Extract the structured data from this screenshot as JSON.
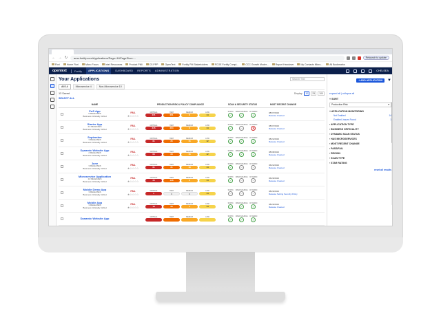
{
  "browser": {
    "url": "ams.fortify.com/Applications/Page=1&PageSize=..."
  },
  "bookmarks": [
    "Fiori",
    "Home Fiori",
    "Micro Focus",
    "Intel Resources",
    "Product PMI",
    "CS PPP",
    "OpenText",
    "Fortify PM Stakeholders",
    "FCOE Fortify Compl...",
    "CCC Growth Moder...",
    "Report Handover",
    "My Contacts Micro...",
    "All Bookmarks"
  ],
  "app_header": {
    "logo": "opentext",
    "product": "Fortify",
    "nav": [
      "APPLICATIONS",
      "DASHBOARD",
      "REPORTS",
      "ADMINISTRATION"
    ],
    "user": "CHELSEA"
  },
  "main": {
    "title": "Your Applications",
    "search_placeholder": "Search Text",
    "tabs": [
      {
        "label": "All  14"
      },
      {
        "label": "Microservice  4"
      },
      {
        "label": "Non-Microservice  10"
      }
    ],
    "saved": "13 Saved",
    "display_label": "Display:",
    "page_sizes": [
      "10",
      "25",
      "100"
    ],
    "select_all": "SELECT ALL",
    "headers": {
      "name": "NAME",
      "risk": "PRODUCTION RISK & POLICY COMPLIANCE",
      "scan": "SCAN & SECURITY STATUS",
      "change": "MOST RECENT CHANGE"
    },
    "risk_labels": [
      "CRITICAL",
      "HIGH",
      "MEDIUM",
      "LOW"
    ],
    "status_labels": [
      "STATIC",
      "OPEN SOURCE",
      "DYNAMIC"
    ],
    "rows": [
      {
        "name": "PoS App",
        "sub1": "5 RELEASES",
        "sub2": "Business Criticality: HIGH",
        "rating": "FAIL",
        "risk": [
          "471",
          "261",
          "6",
          "14"
        ],
        "status": [
          "ok",
          "ok",
          "ok"
        ],
        "date": "08/07/2023",
        "change": "Release Created"
      },
      {
        "name": "Starter App",
        "sub1": "21 RELEASES",
        "sub2": "Business Criticality: HIGH",
        "rating": "FAIL",
        "risk": [
          "345",
          "264",
          "6",
          "14"
        ],
        "status": [
          "ok",
          "none",
          "fail"
        ],
        "date": "08/07/2023",
        "change": "Release Created"
      },
      {
        "name": "September",
        "sub1": "3 RELEASES",
        "sub2": "Business Criticality: HIGH",
        "rating": "FAIL",
        "risk": [
          "61",
          "25",
          "15",
          "12"
        ],
        "status": [
          "ok",
          "ok",
          "ok"
        ],
        "date": "08/22/2023",
        "change": "Release Created"
      },
      {
        "name": "Dynamic Website App",
        "sub1": "2 RELEASES",
        "sub2": "Business Criticality: HIGH",
        "rating": "FAIL",
        "risk": [
          "63",
          "23",
          "16",
          "12"
        ],
        "status": [
          "ok",
          "ok",
          "ok"
        ],
        "date": "08/08/2023",
        "change": "Release Created"
      },
      {
        "name": "June",
        "sub1": "3 RELEASES",
        "sub2": "Business Criticality: HIGH",
        "rating": "FAIL",
        "risk": [
          "61",
          "21",
          "18",
          "14"
        ],
        "status": [
          "ok",
          "none",
          "none"
        ],
        "date": "06/22/2023",
        "change": "Release Created"
      },
      {
        "name": "Microservice Application",
        "sub1": "12 RELEASES",
        "sub2": "Business Criticality: HIGH",
        "rating": "FAIL",
        "risk": [
          "34",
          "128",
          "2",
          "14"
        ],
        "status": [
          "ok",
          "none",
          "none"
        ],
        "date": "06/29/2023",
        "change": "Release Created"
      },
      {
        "name": "Mobile Demo App",
        "sub1": "3 RELEASES",
        "sub2": "Business Criticality: HIGH",
        "rating": "FAIL",
        "risk": [
          "1",
          "0",
          "0",
          "14"
        ],
        "status": [
          "none",
          "none",
          "none"
        ],
        "date": "08/29/2023",
        "change": "Release Setting Security Policy"
      },
      {
        "name": "Mobile App",
        "sub1": "3 RELEASES",
        "sub2": "Business Criticality: HIGH",
        "rating": "FAIL",
        "risk": [
          "19",
          "26",
          "4",
          "14"
        ],
        "status": [
          "ok",
          "ok",
          "ok"
        ],
        "date": "08/29/2023",
        "change": "Release Created"
      },
      {
        "name": "Dynamic Website App",
        "sub1": "",
        "sub2": "",
        "rating": "",
        "risk": [
          "",
          "",
          "",
          ""
        ],
        "status": [
          "ok",
          "ok",
          "ok"
        ],
        "date": "",
        "change": ""
      }
    ]
  },
  "right_panel": {
    "add_button": "+ ADD APPLICATION",
    "expand_links": "expand all | collapse all",
    "sort_header": "SORT",
    "sort_value": "Production Risk",
    "facets": [
      {
        "label": "APPLICATION MONITORING",
        "options": [
          {
            "name": "Not Enabled",
            "count": "14"
          },
          {
            "name": "Enabled, Issues Found",
            "count": "1"
          }
        ]
      },
      {
        "label": "APPLICATION TYPE",
        "options": []
      },
      {
        "label": "BUSINESS CRITICALITY",
        "options": []
      },
      {
        "label": "DYNAMIC SCAN STATUS",
        "options": []
      },
      {
        "label": "HAS MICROSERVICES",
        "options": []
      },
      {
        "label": "MOST RECENT CHANGE",
        "options": []
      },
      {
        "label": "PASS/FAIL",
        "options": []
      },
      {
        "label": "REGION",
        "options": []
      },
      {
        "label": "SCAN TYPE",
        "options": []
      },
      {
        "label": "STAR RATING",
        "options": []
      }
    ],
    "reset": "reset all results"
  }
}
